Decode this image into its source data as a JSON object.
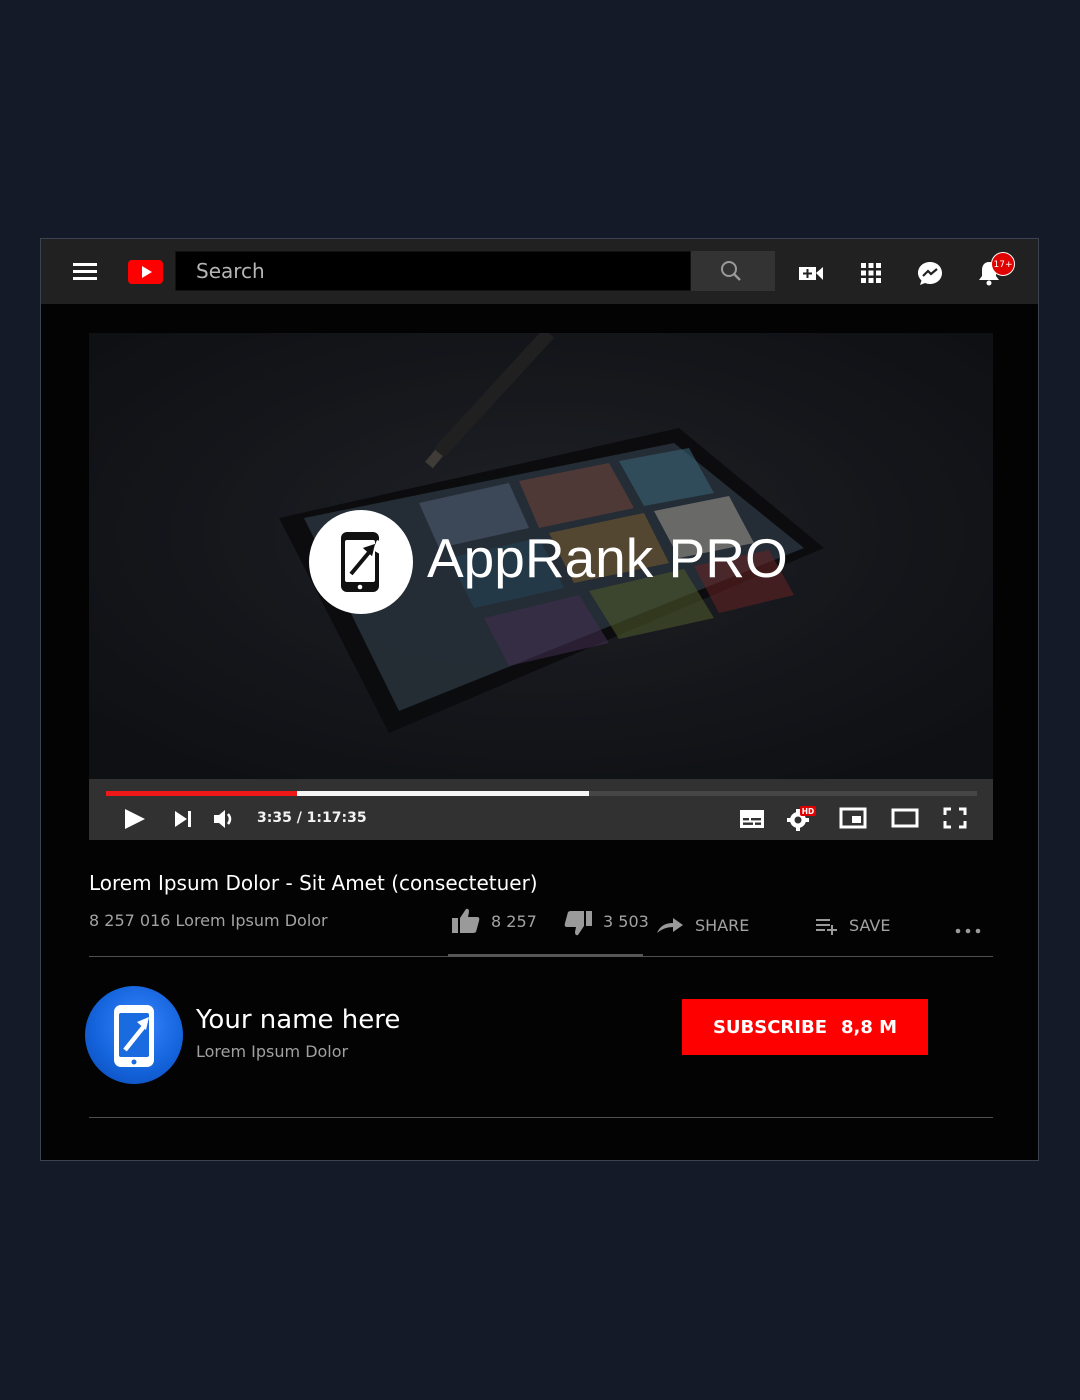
{
  "topbar": {
    "search_placeholder": "Search",
    "notification_count": "17+",
    "icons": [
      "menu-icon",
      "youtube-logo",
      "search-icon",
      "create-video-icon",
      "apps-grid-icon",
      "messages-icon",
      "bell-icon"
    ]
  },
  "player": {
    "brand_name": "AppRank PRO",
    "time_display": "3:35 / 1:17:35",
    "progress_played_pct": 21.9,
    "progress_buffered_pct": 55.5,
    "quality_badge": "HD",
    "colors": {
      "progress": "#ee1818",
      "buffer": "#f5f5f5",
      "accent": "#fe0000"
    }
  },
  "video": {
    "title": "Lorem Ipsum Dolor - Sit Amet (consectetuer)",
    "views": "8 257 016 Lorem Ipsum Dolor",
    "likes": "8 257",
    "dislikes": "3 503",
    "share_label": "SHARE",
    "save_label": "SAVE"
  },
  "channel": {
    "name": "Your name here",
    "subtitle": "Lorem Ipsum Dolor",
    "subscribe_label": "SUBSCRIBE",
    "subscriber_count": "8,8 M"
  }
}
